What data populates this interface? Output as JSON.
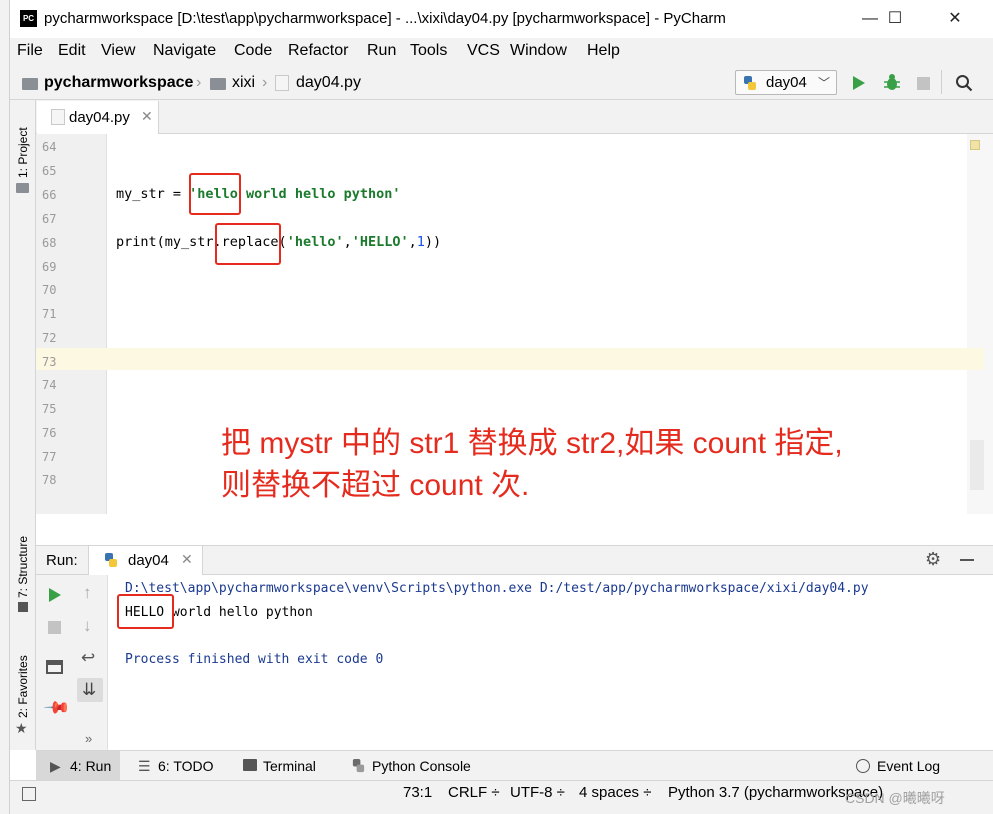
{
  "window": {
    "title": "pycharmworkspace [D:\\test\\app\\pycharmworkspace] - ...\\xixi\\day04.py [pycharmworkspace] - PyCharm",
    "app_icon": "PC",
    "minimize": "—",
    "maximize": "☐",
    "close": "✕"
  },
  "menu": [
    "File",
    "Edit",
    "View",
    "Navigate",
    "Code",
    "Refactor",
    "Run",
    "Tools",
    "VCS",
    "Window",
    "Help"
  ],
  "breadcrumb": {
    "project": "pycharmworkspace",
    "folder": "xixi",
    "file": "day04.py"
  },
  "run_config": "day04",
  "side_tools": {
    "project": "1: Project",
    "structure": "7: Structure",
    "favorites": "2: Favorites"
  },
  "editor": {
    "tab_label": "day04.py",
    "line_numbers": [
      "64",
      "65",
      "66",
      "67",
      "68",
      "69",
      "70",
      "71",
      "72",
      "73",
      "74",
      "75",
      "76",
      "77",
      "78"
    ],
    "code": {
      "l66_var": "my_str = ",
      "l66_str": "'hello world hello python'",
      "l68_fn": "print(my_str.replace(",
      "l68_arg1": "'hello'",
      "l68_comma1": ",",
      "l68_arg2": "'HELLO'",
      "l68_comma2": ",",
      "l68_num": "1",
      "l68_close": "))"
    }
  },
  "annotation": {
    "line1": "把 mystr 中的 str1 替换成 str2,如果 count 指定,",
    "line2": "则替换不超过 count 次."
  },
  "run_panel": {
    "label": "Run:",
    "tab": "day04",
    "console": {
      "command": "D:\\test\\app\\pycharmworkspace\\venv\\Scripts\\python.exe D:/test/app/pycharmworkspace/xixi/day04.py",
      "output": "HELLO world hello python",
      "exit": "Process finished with exit code 0"
    }
  },
  "bottom_tabs": {
    "run": "4: Run",
    "todo": "6: TODO",
    "terminal": "Terminal",
    "python_console": "Python Console",
    "event_log": "Event Log"
  },
  "status": {
    "position": "73:1",
    "line_sep": "CRLF ÷",
    "encoding": "UTF-8 ÷",
    "indent": "4 spaces ÷",
    "interpreter": "Python 3.7 (pycharmworkspace)"
  },
  "watermark": "CSDN @曦曦呀",
  "colors": {
    "accent_red": "#e52a1e",
    "run_green": "#3aa047",
    "string_green": "#1b7a2c",
    "number_blue": "#1750eb"
  }
}
